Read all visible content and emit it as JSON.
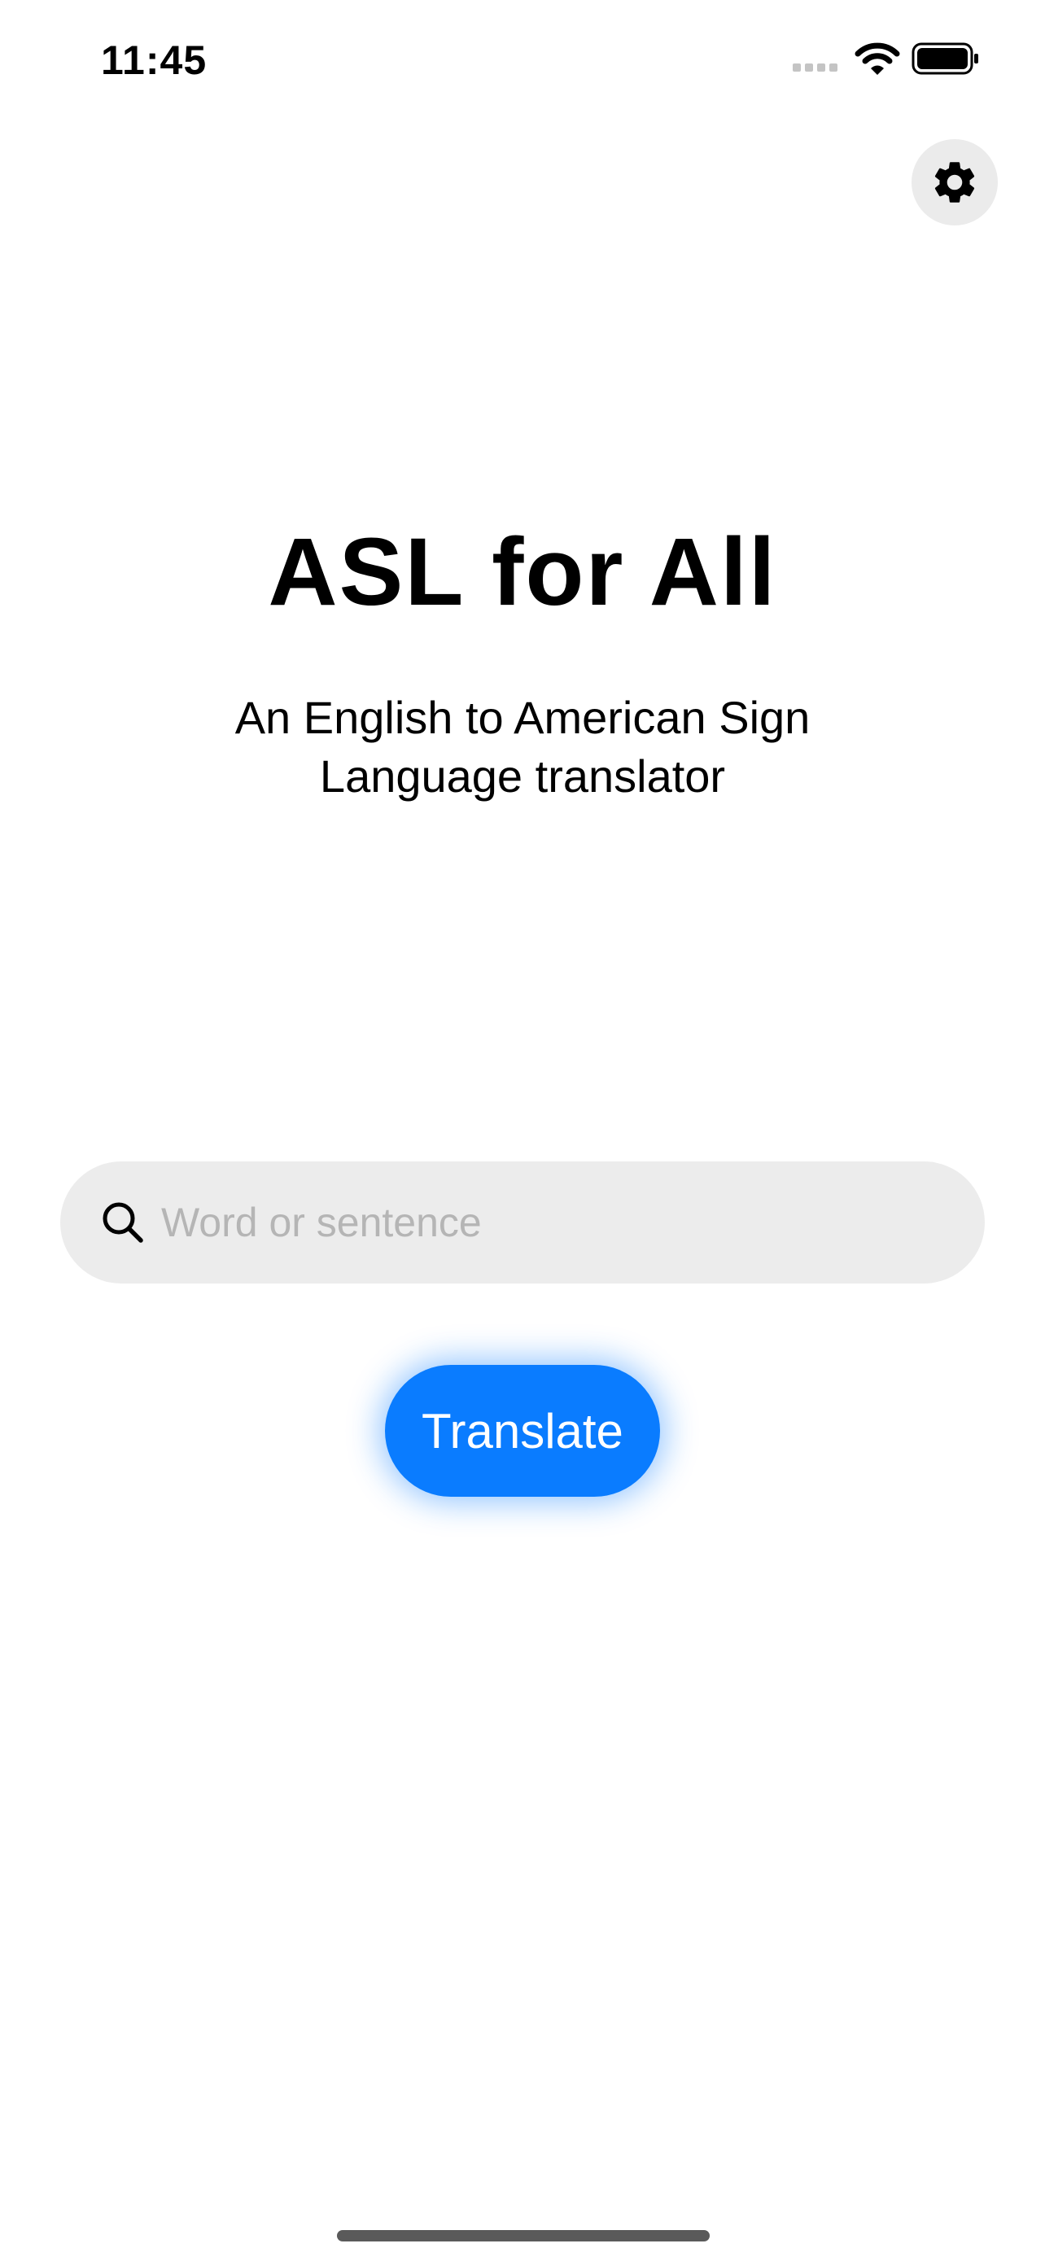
{
  "status_bar": {
    "time": "11:45",
    "icons": [
      "signal-icon",
      "wifi-icon",
      "battery-icon"
    ]
  },
  "settings": {
    "icon": "gear-icon"
  },
  "header": {
    "title": "ASL for All",
    "subtitle": "An English to American Sign Language translator"
  },
  "search": {
    "icon": "search-icon",
    "value": "",
    "placeholder": "Word or sentence"
  },
  "translate_button": {
    "label": "Translate"
  },
  "colors": {
    "accent": "#0a7cff",
    "search_background": "#ececec",
    "settings_background": "#ebebeb",
    "placeholder": "#b5b5b5"
  }
}
